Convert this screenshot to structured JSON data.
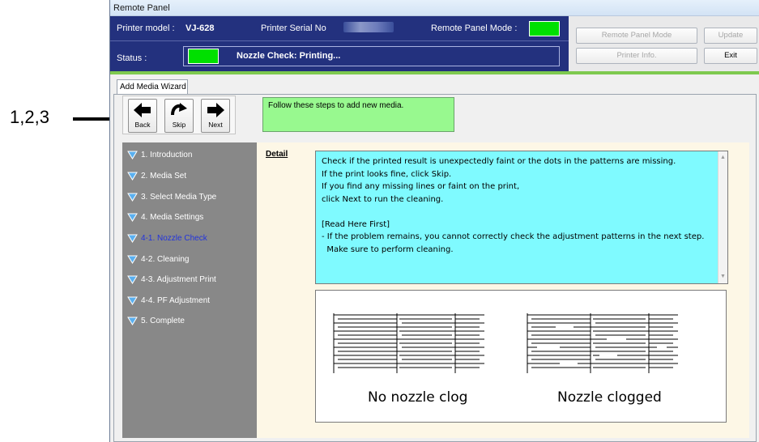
{
  "callout": {
    "label": "1,2,3"
  },
  "window": {
    "title": "Remote Panel"
  },
  "header": {
    "printer_model_label": "Printer model :",
    "printer_model_value": "VJ-628",
    "serial_label": "Printer Serial No",
    "remote_mode_label": "Remote Panel Mode :",
    "status_label": "Status :",
    "status_text": "Nozzle Check: Printing...",
    "indicator_color": "#00e000",
    "panel_color": "#23317e"
  },
  "buttons": {
    "remote_panel_mode": "Remote Panel Mode",
    "update": "Update",
    "printer_info": "Printer Info.",
    "exit": "Exit"
  },
  "tab": {
    "label": "Add Media Wizard"
  },
  "nav": {
    "back": "Back",
    "skip": "Skip",
    "next": "Next"
  },
  "instruction": "Follow these steps to add new media.",
  "steps": [
    {
      "label": "1. Introduction",
      "active": false
    },
    {
      "label": "2. Media Set",
      "active": false
    },
    {
      "label": "3. Select Media Type",
      "active": false
    },
    {
      "label": "4. Media Settings",
      "active": false
    },
    {
      "label": "4-1. Nozzle Check",
      "active": true
    },
    {
      "label": "4-2. Cleaning",
      "active": false
    },
    {
      "label": "4-3. Adjustment Print",
      "active": false
    },
    {
      "label": "4-4. PF Adjustment",
      "active": false
    },
    {
      "label": "5. Complete",
      "active": false
    }
  ],
  "detail": {
    "label": "Detail",
    "text": "Check if the printed result is unexpectedly faint or the dots in the patterns are missing.\nIf the print looks fine, click Skip.\nIf you find any missing lines or faint on the print,\nclick Next to run the cleaning.\n\n[Read Here First]\n- If the problem remains, you cannot correctly check the adjustment patterns in the next step.\n  Make sure to perform cleaning."
  },
  "illustration": {
    "left_caption": "No nozzle clog",
    "right_caption": "Nozzle clogged"
  }
}
